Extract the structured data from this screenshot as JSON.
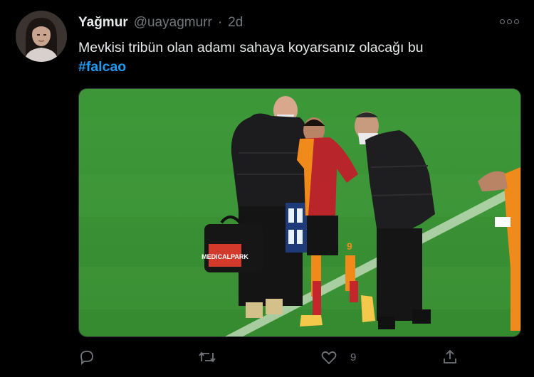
{
  "tweet": {
    "display_name": "Yağmur",
    "handle": "@uayagmurr",
    "separator": "·",
    "time": "2d",
    "text": "Mevkisi tribün olan adamı sahaya koyarsanız olacağı bu",
    "hashtag": "#falcao",
    "media_bag_label": "MEDICALPARK",
    "media_jersey_number": "9",
    "colors": {
      "accent": "#1d9bf0",
      "pitch": "#3f9a3a",
      "text_primary": "#e7e9ea",
      "text_secondary": "#71767b"
    }
  },
  "actions": {
    "reply_icon": "reply-icon",
    "retweet_icon": "retweet-icon",
    "like_icon": "heart-icon",
    "like_count": "9",
    "share_icon": "share-icon"
  },
  "more_icon": "more-icon"
}
